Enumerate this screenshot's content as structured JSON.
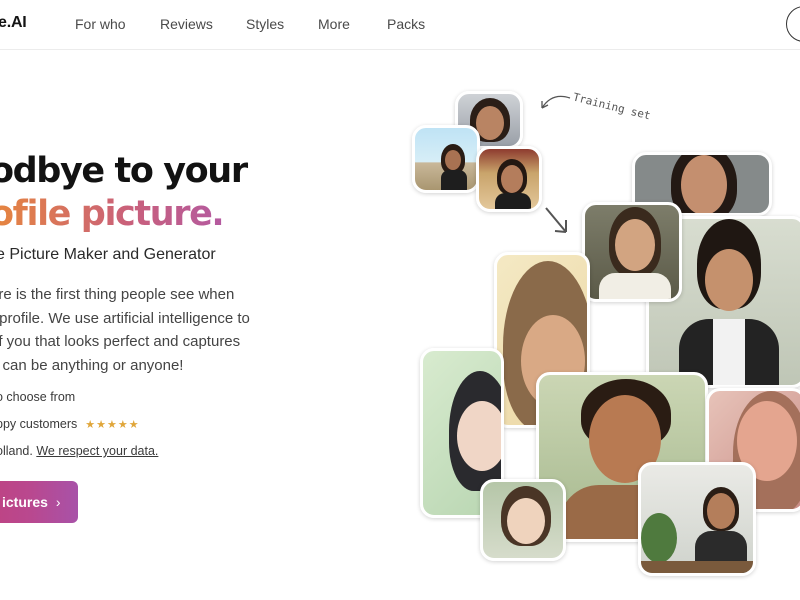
{
  "nav": {
    "logo": "e.AI",
    "links": [
      "For who",
      "Reviews",
      "Styles",
      "More",
      "Packs"
    ]
  },
  "hero": {
    "title_line1": "odbye to your",
    "title_line2": "ofile picture.",
    "subtitle": "e Picture Maker and Generator",
    "description": [
      "ure is the first thing people see when",
      "r profile. We use artificial intelligence to",
      "of you that looks perfect and captures",
      "u can be anything or anyone!"
    ],
    "facts": {
      "choose": "o choose from",
      "customers": "ppy customers",
      "stars": "★★★★★",
      "holland": "olland.",
      "respect_link": "We respect your data."
    },
    "cta_label": "ictures",
    "cta_chevron": "›"
  },
  "collage": {
    "training_label": "Training set",
    "colors": {
      "accent_orange": "#e7873d",
      "accent_pink": "#c9607b",
      "accent_purple": "#b45aa0",
      "star": "#e0a63a"
    }
  }
}
